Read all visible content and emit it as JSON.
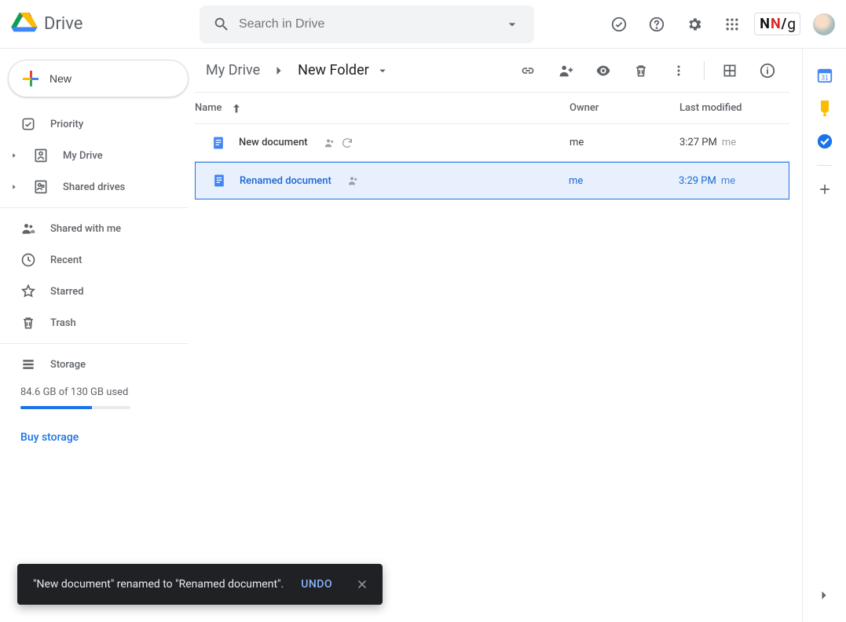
{
  "app": {
    "name": "Drive"
  },
  "search": {
    "placeholder": "Search in Drive",
    "value": ""
  },
  "ext_badge": "NN/g",
  "new_button": "New",
  "sidebar": {
    "priority": "Priority",
    "my_drive": "My Drive",
    "shared_drives": "Shared drives",
    "shared_with_me": "Shared with me",
    "recent": "Recent",
    "starred": "Starred",
    "trash": "Trash",
    "storage_label": "Storage",
    "storage_text": "84.6 GB of 130 GB used",
    "storage_pct": 65,
    "buy_storage": "Buy storage"
  },
  "breadcrumbs": [
    {
      "label": "My Drive"
    },
    {
      "label": "New Folder"
    }
  ],
  "columns": {
    "name": "Name",
    "owner": "Owner",
    "modified": "Last modified"
  },
  "files": [
    {
      "name": "New document",
      "owner": "me",
      "modified_time": "3:27 PM",
      "modified_by": "me",
      "shared": true,
      "syncing": true,
      "selected": false
    },
    {
      "name": "Renamed document",
      "owner": "me",
      "modified_time": "3:29 PM",
      "modified_by": "me",
      "shared": true,
      "syncing": false,
      "selected": true
    }
  ],
  "toast": {
    "message": "\"New document\" renamed to \"Renamed document\".",
    "action": "UNDO"
  }
}
